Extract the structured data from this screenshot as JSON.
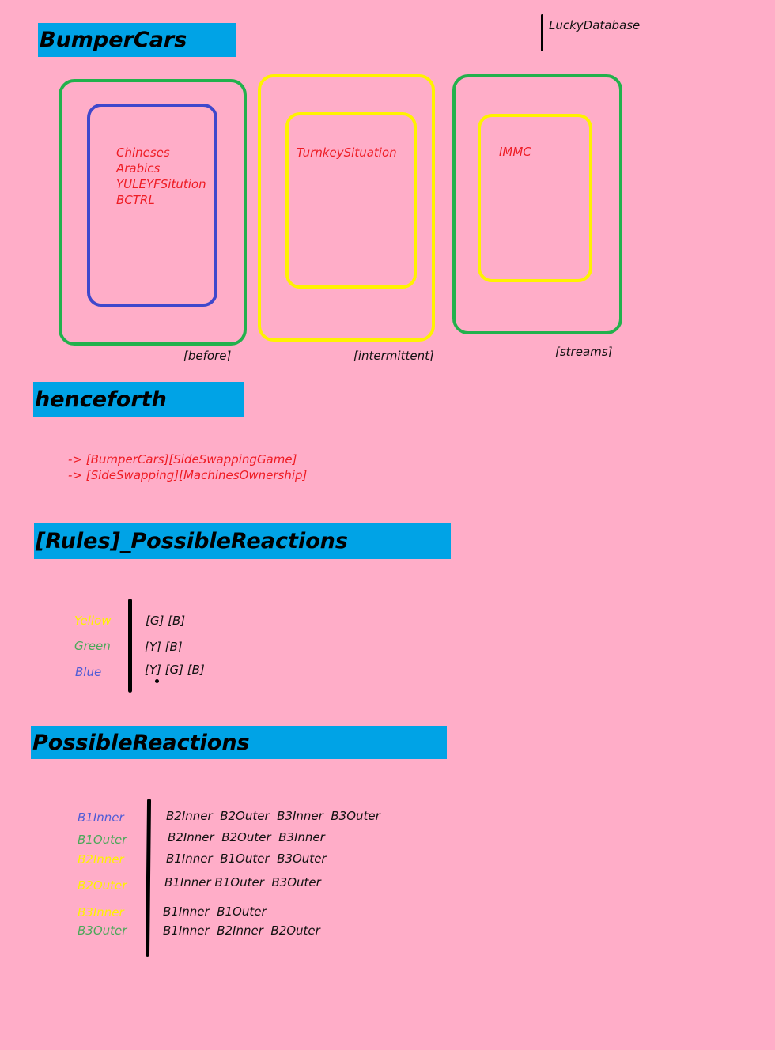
{
  "colors": {
    "background": "#ffadc8",
    "banner": "#00a3e6",
    "green": "#22b14c",
    "yellow": "#fff200",
    "blue": "#3f48cc",
    "red": "#ee1c24",
    "green_text": "#4ca85a",
    "blue_text": "#4f5cd6"
  },
  "header": {
    "database_label": "LuckyDatabase"
  },
  "sections": {
    "bumper_cars": {
      "title": "BumperCars",
      "box1": {
        "items": [
          "Chineses",
          "Arabics",
          "YULEYFSitution",
          "BCTRL"
        ],
        "caption": "[before]"
      },
      "box2": {
        "items": [
          "TurnkeySituation"
        ],
        "caption": "[intermittent]"
      },
      "box3": {
        "items": [
          "IMMC"
        ],
        "caption": "[streams]"
      }
    },
    "henceforth": {
      "title": "henceforth",
      "lines": [
        "-> [BumperCars][SideSwappingGame]",
        "-> [SideSwapping][MachinesOwnership]"
      ]
    },
    "rules": {
      "title": "[Rules]_PossibleReactions",
      "rows": [
        {
          "label": "Yellow",
          "value": "[G] [B]"
        },
        {
          "label": "Green",
          "value": "[Y] [B]"
        },
        {
          "label": "Blue",
          "value": "[Y] [G] [B]"
        }
      ]
    },
    "possible_reactions": {
      "title": "PossibleReactions",
      "rows": [
        {
          "label": "B1Inner",
          "value": "B2Inner  B2Outer  B3Inner  B3Outer"
        },
        {
          "label": "B1Outer",
          "value": "B2Inner  B2Outer  B3Inner"
        },
        {
          "label": "B2Inner",
          "value": "B1Inner  B1Outer  B3Outer"
        },
        {
          "label": "B2Outer",
          "value": "B1Inner B1Outer  B3Outer"
        },
        {
          "label": "B3Inner",
          "value": "B1Inner  B1Outer"
        },
        {
          "label": "B3Outer",
          "value": "B1Inner  B2Inner  B2Outer"
        }
      ]
    }
  }
}
